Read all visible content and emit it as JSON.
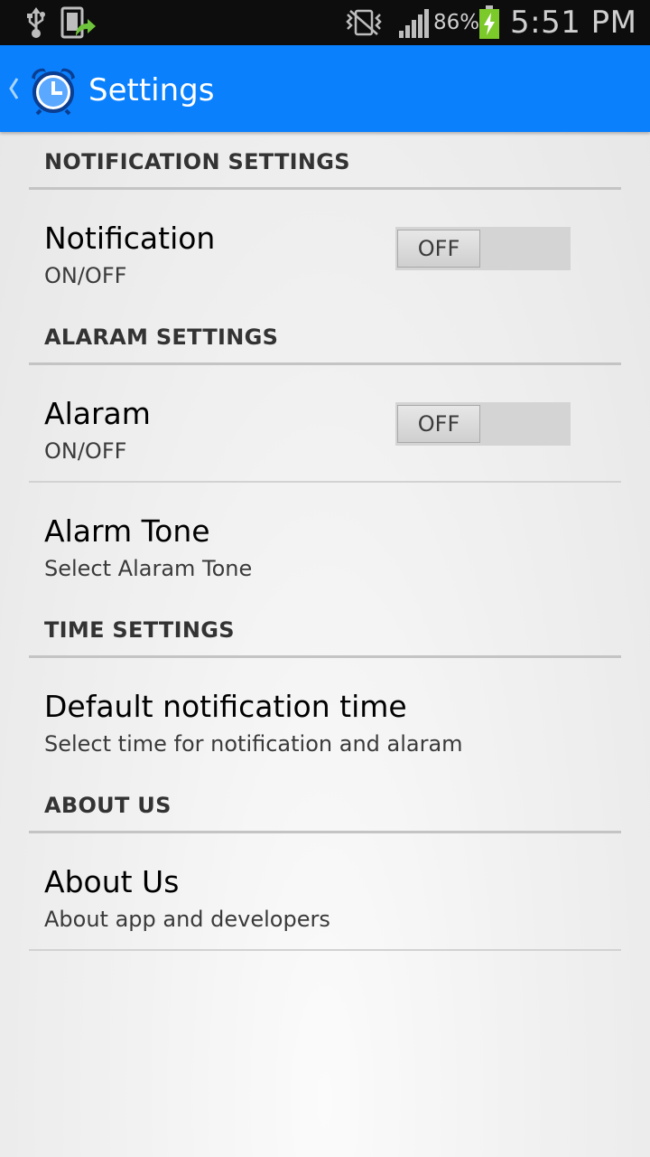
{
  "status_bar": {
    "battery_percent": "86%",
    "time": "5:51 PM",
    "icons": [
      "usb-icon",
      "phone-upload-icon",
      "vibrate-icon",
      "signal-icon",
      "battery-charging-icon"
    ]
  },
  "action_bar": {
    "title": "Settings",
    "color": "#0a80fd",
    "icons": [
      "back-chevron-icon",
      "alarm-clock-icon"
    ]
  },
  "categories": {
    "notification": {
      "title": "NOTIFICATION SETTINGS"
    },
    "alarm": {
      "title": "ALARAM SETTINGS"
    },
    "time": {
      "title": "TIME SETTINGS"
    },
    "about": {
      "title": "ABOUT US"
    }
  },
  "prefs": {
    "notification": {
      "title": "Notification",
      "summary": "ON/OFF",
      "switch_state": "OFF"
    },
    "alarm": {
      "title": "Alaram",
      "summary": "ON/OFF",
      "switch_state": "OFF"
    },
    "alarm_tone": {
      "title": "Alarm Tone",
      "summary": "Select Alaram Tone"
    },
    "default_time": {
      "title": "Default notification time",
      "summary": "Select time for notification and alaram"
    },
    "about_us": {
      "title": "About Us",
      "summary": "About app and developers"
    }
  }
}
